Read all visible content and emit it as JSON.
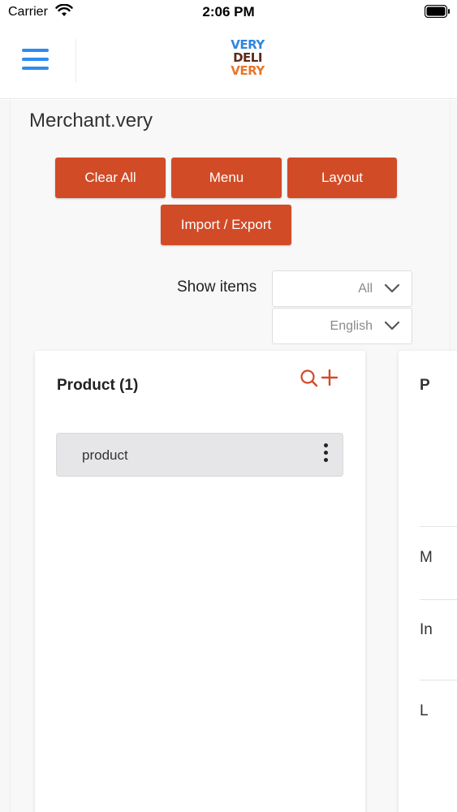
{
  "status_bar": {
    "carrier": "Carrier",
    "time": "2:06 PM"
  },
  "header": {
    "logo_lines": [
      "VERY",
      "DELI",
      "VERY"
    ],
    "logo_colors": [
      "#2e86de",
      "#5b2a1a",
      "#e8762c"
    ]
  },
  "page": {
    "title": "Merchant.very"
  },
  "toolbar": {
    "clear_all": "Clear All",
    "menu": "Menu",
    "layout": "Layout",
    "import_export": "Import / Export"
  },
  "filters": {
    "show_items_label": "Show items",
    "items_value": "All",
    "language_value": "English"
  },
  "product_card": {
    "title": "Product (1)",
    "items": [
      {
        "label": "product"
      }
    ]
  },
  "second_card": {
    "title_initial": "P",
    "rows": [
      "M",
      "In",
      "L"
    ]
  },
  "colors": {
    "accent": "#d14b27",
    "menu_icon": "#2d8cf0"
  }
}
